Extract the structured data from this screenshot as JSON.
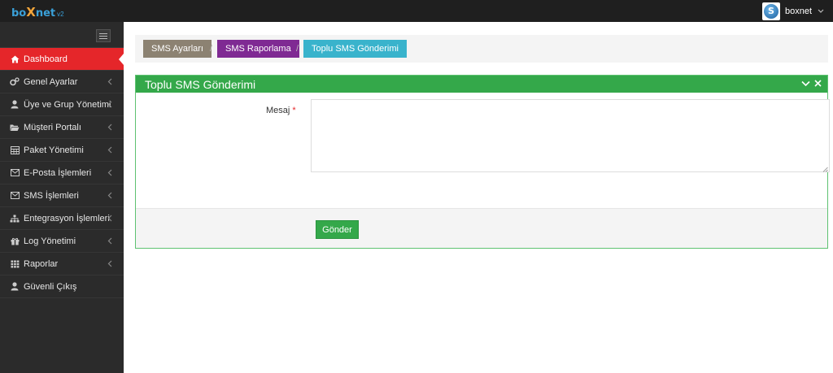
{
  "app": {
    "logo_main_1": "bo",
    "logo_x": "X",
    "logo_main_2": "net",
    "logo_version": "v2",
    "username": "boxnet",
    "accent": "#e5262a"
  },
  "sidebar": {
    "items": [
      {
        "label": "Dashboard",
        "icon": "home-icon",
        "active": true
      },
      {
        "label": "Genel Ayarlar",
        "icon": "cogs-icon"
      },
      {
        "label": "Üye ve Grup Yönetimi",
        "icon": "user-icon"
      },
      {
        "label": "Müşteri Portalı",
        "icon": "folder-icon"
      },
      {
        "label": "Paket Yönetimi",
        "icon": "table-icon"
      },
      {
        "label": "E-Posta İşlemleri",
        "icon": "envelope-icon"
      },
      {
        "label": "SMS İşlemleri",
        "icon": "envelope-icon"
      },
      {
        "label": "Entegrasyon İşlemleri",
        "icon": "sitemap-icon"
      },
      {
        "label": "Log Yönetimi",
        "icon": "gift-icon"
      },
      {
        "label": "Raporlar",
        "icon": "grid-icon"
      },
      {
        "label": "Güvenli Çıkış",
        "icon": "user-icon"
      }
    ]
  },
  "breadcrumb": {
    "items": [
      {
        "label": "SMS Ayarları",
        "color": "#8c8272"
      },
      {
        "label": "SMS Raporlama",
        "color": "#7f2a93"
      },
      {
        "label": "Toplu SMS Gönderimi",
        "color": "#39b3cc"
      }
    ],
    "separator": "/"
  },
  "panel": {
    "title": "Toplu SMS Gönderimi",
    "color": "#34a84a"
  },
  "form": {
    "message_label": "Mesaj",
    "required_mark": "*",
    "message_value": "",
    "submit_label": "Gönder"
  }
}
